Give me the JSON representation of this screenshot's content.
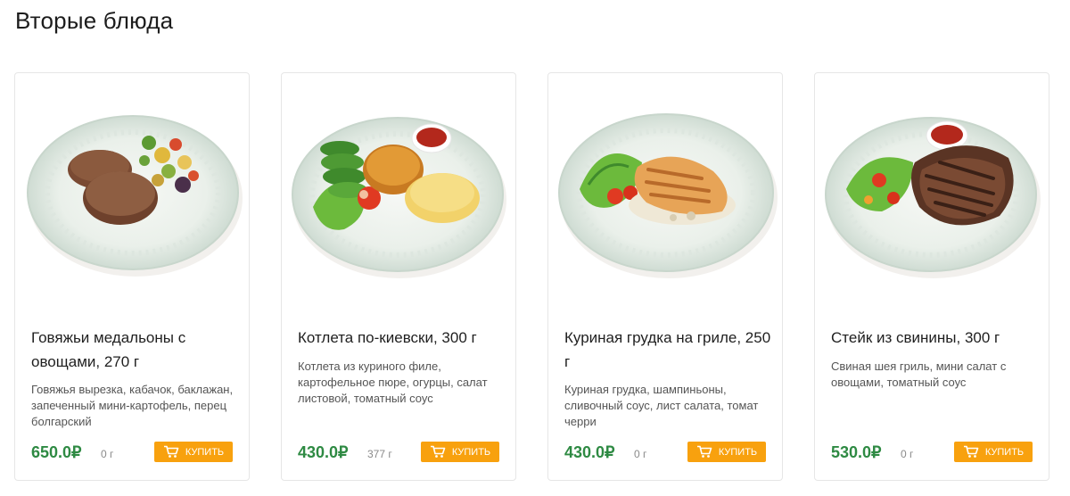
{
  "section": {
    "title": "Вторые блюда"
  },
  "currency": "₽",
  "buy_label": "Купить",
  "products": [
    {
      "name": "Говяжьи медальоны с овощами, 270 г",
      "description": "Говяжья вырезка, кабачок, баклажан, запеченный мини-картофель, перец болгарский",
      "price": "650.0₽",
      "weight": "0 г",
      "image": "beef-medallions-plate"
    },
    {
      "name": "Котлета по-киевски, 300 г",
      "description": "Котлета из куриного филе, картофельное пюре, огурцы, салат листовой, томатный соус",
      "price": "430.0₽",
      "weight": "377 г",
      "image": "chicken-kiev-plate"
    },
    {
      "name": "Куриная грудка на гриле, 250 г",
      "description": "Куриная грудка, шампиньоны, сливочный соус, лист салата, томат черри",
      "price": "430.0₽",
      "weight": "0 г",
      "image": "grilled-chicken-plate"
    },
    {
      "name": "Стейк из свинины, 300 г",
      "description": "Свиная шея гриль, мини салат с овощами, томатный соус",
      "price": "530.0₽",
      "weight": "0 г",
      "image": "pork-steak-plate"
    }
  ],
  "colors": {
    "price": "#2e8a43",
    "buy_button": "#f8a10e",
    "card_border": "#e6e6e6"
  }
}
